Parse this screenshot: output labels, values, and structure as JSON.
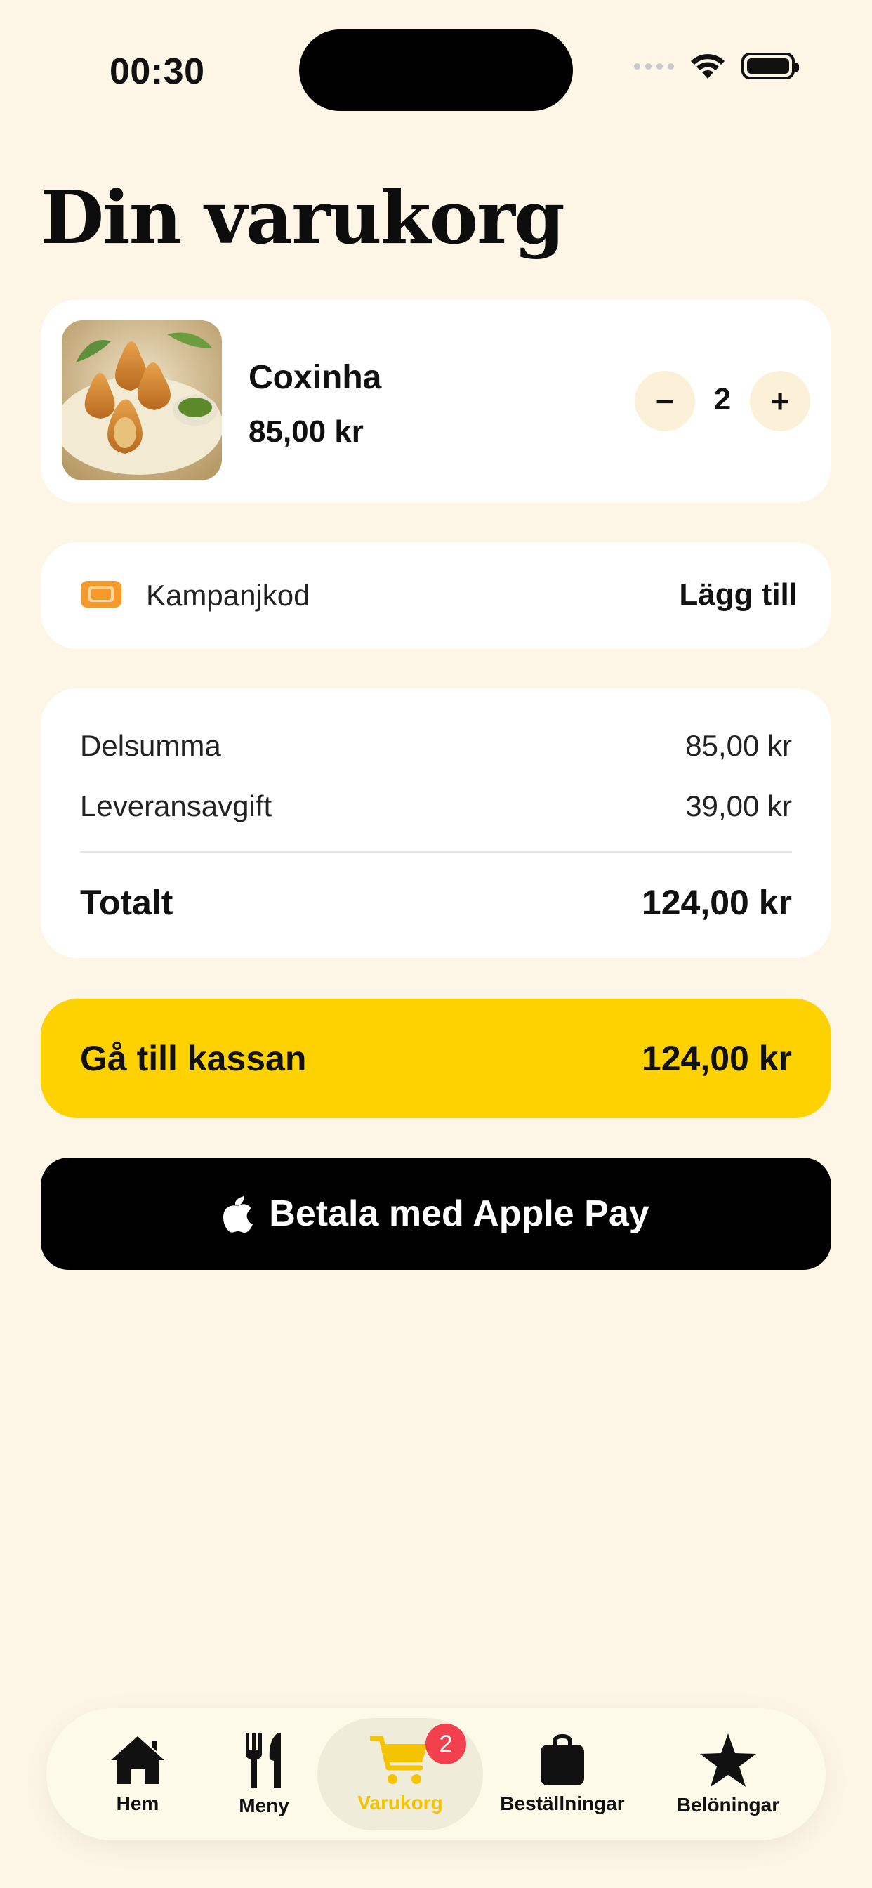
{
  "status_bar": {
    "time": "00:30"
  },
  "page": {
    "title": "Din varukorg"
  },
  "cart_item": {
    "name": "Coxinha",
    "price": "85,00 kr",
    "quantity": "2",
    "minus_label": "−",
    "plus_label": "+"
  },
  "promo": {
    "label": "Kampanjkod",
    "action": "Lägg till"
  },
  "summary": {
    "subtotal_label": "Delsumma",
    "subtotal_value": "85,00 kr",
    "fee_label": "Leveransavgift",
    "fee_value": "39,00 kr",
    "total_label": "Totalt",
    "total_value": "124,00 kr"
  },
  "checkout": {
    "label": "Gå till kassan",
    "amount": "124,00 kr"
  },
  "apple_pay": {
    "label": "Betala med Apple Pay"
  },
  "tabbar": {
    "home": "Hem",
    "menu": "Meny",
    "cart": "Varukorg",
    "cart_badge": "2",
    "orders": "Beställningar",
    "rewards": "Belöningar"
  },
  "colors": {
    "background": "#FDF6E6",
    "accent_yellow": "#FDD200",
    "badge_red": "#F2404E",
    "promo_orange": "#F39A2A"
  },
  "icons": [
    "wifi-icon",
    "battery-icon",
    "ticket-icon",
    "apple-icon",
    "home-icon",
    "fork-knife-icon",
    "cart-icon",
    "bag-icon",
    "star-icon"
  ]
}
